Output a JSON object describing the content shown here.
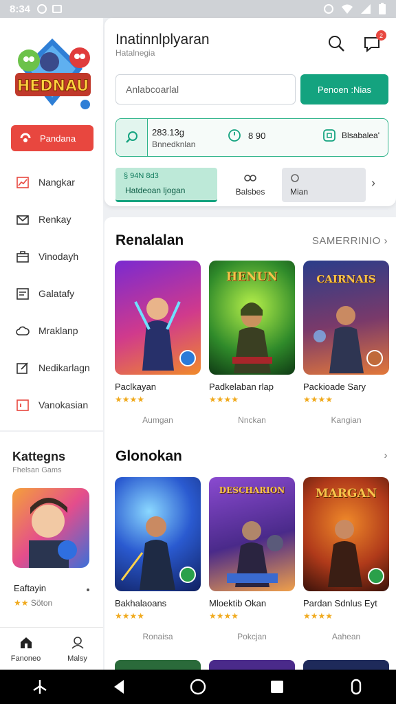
{
  "status_bar": {
    "time": "8:34"
  },
  "sidebar": {
    "logo_text": "HEDNAU",
    "play_button": "Pandana",
    "items": [
      {
        "label": "Nangkar",
        "icon": "chart-icon"
      },
      {
        "label": "Renkay",
        "icon": "mail-icon"
      },
      {
        "label": "Vinodayh",
        "icon": "store-icon"
      },
      {
        "label": "Galatafy",
        "icon": "document-icon"
      },
      {
        "label": "Mraklanp",
        "icon": "cloud-icon"
      },
      {
        "label": "Nedikarlagn",
        "icon": "edit-icon"
      },
      {
        "label": "Vanokasian",
        "icon": "box-icon"
      }
    ]
  },
  "category_panel": {
    "title": "Kattegns",
    "subtitle": "Fhelsan Gams",
    "item_name": "Eaftayin",
    "item_rating": "Söton"
  },
  "bottom_tabs": [
    {
      "label": "Fanoneo",
      "icon": "home-icon"
    },
    {
      "label": "Malsy",
      "icon": "profile-icon"
    }
  ],
  "header": {
    "title": "Inatinnlplyaran",
    "subtitle": "Hatalnegia",
    "notification_count": "2"
  },
  "search": {
    "placeholder": "Anlabcoarlal",
    "action_label": "Penoen :Nias"
  },
  "stats": {
    "main_value": "283.13g",
    "main_label": "Bnnedknlan",
    "mid_value": "8 90",
    "right_label": "Blsabalea'"
  },
  "filters": {
    "active_top": "§ 94N 8d3",
    "active_bottom": "Hatdeoan ljogan",
    "chip_2": "Balsbes",
    "chip_3": "Mian"
  },
  "sections": [
    {
      "title": "Renalalan",
      "more_label": "SAMERRINIO",
      "games": [
        {
          "name": "Paclkayan",
          "stars": "★★★★",
          "meta": "Aumgan",
          "art_title": ""
        },
        {
          "name": "Padkelaban rlap",
          "stars": "★★★★",
          "meta": "Nnckan",
          "art_title": "HENUN"
        },
        {
          "name": "Packioade Sary",
          "stars": "★★★★",
          "meta": "Kangian",
          "art_title": "CAIRNAIS"
        }
      ]
    },
    {
      "title": "Glonokan",
      "more_label": "",
      "games": [
        {
          "name": "Bakhalaoans",
          "stars": "★★★★",
          "meta": "Ronaisa",
          "art_title": ""
        },
        {
          "name": "Mloektib Okan",
          "stars": "★★★★",
          "meta": "Pokcjan",
          "art_title": "DESCHARION"
        },
        {
          "name": "Pardan Sdnlus Eyt",
          "stars": "★★★★",
          "meta": "Aahean",
          "art_title": "MARGAN"
        }
      ]
    }
  ],
  "colors": {
    "accent_green": "#14a37f",
    "accent_red": "#e8473f",
    "star": "#f0a91c"
  }
}
